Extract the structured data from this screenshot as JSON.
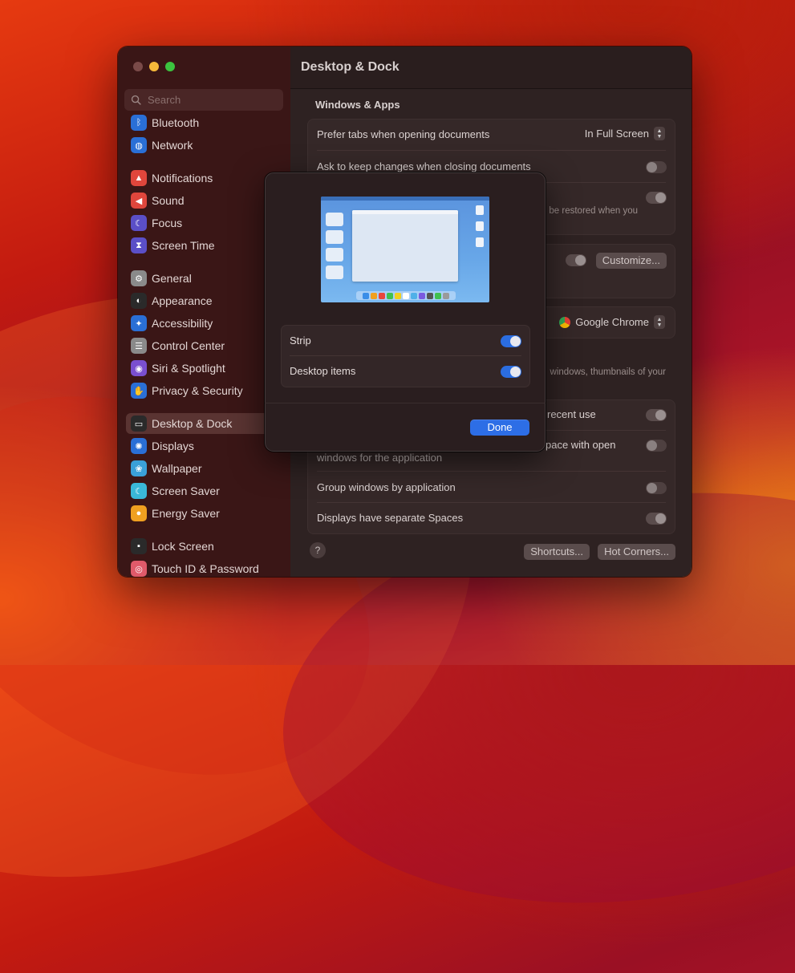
{
  "sidebar": {
    "search_placeholder": "Search",
    "items": [
      {
        "label": "Bluetooth",
        "icon": "bluetooth-icon",
        "color": "#2a6fd6"
      },
      {
        "label": "Network",
        "icon": "globe-icon",
        "color": "#2a6fd6"
      },
      {
        "label": "Notifications",
        "icon": "bell-icon",
        "color": "#e0463c"
      },
      {
        "label": "Sound",
        "icon": "speaker-icon",
        "color": "#e0463c"
      },
      {
        "label": "Focus",
        "icon": "moon-icon",
        "color": "#5b4fc7"
      },
      {
        "label": "Screen Time",
        "icon": "hourglass-icon",
        "color": "#5b4fc7"
      },
      {
        "label": "General",
        "icon": "gear-icon",
        "color": "#8a8a8a"
      },
      {
        "label": "Appearance",
        "icon": "contrast-icon",
        "color": "#2a2a2a"
      },
      {
        "label": "Accessibility",
        "icon": "accessibility-icon",
        "color": "#2a6fd6"
      },
      {
        "label": "Control Center",
        "icon": "switches-icon",
        "color": "#8a8a8a"
      },
      {
        "label": "Siri & Spotlight",
        "icon": "siri-icon",
        "color": "#7a4fd0"
      },
      {
        "label": "Privacy & Security",
        "icon": "hand-icon",
        "color": "#2a6fd6"
      },
      {
        "label": "Desktop & Dock",
        "icon": "dock-icon",
        "color": "#2a2a2a"
      },
      {
        "label": "Displays",
        "icon": "sun-icon",
        "color": "#2a6fd6"
      },
      {
        "label": "Wallpaper",
        "icon": "flower-icon",
        "color": "#3aa0d8"
      },
      {
        "label": "Screen Saver",
        "icon": "screensaver-icon",
        "color": "#3ab8d8"
      },
      {
        "label": "Energy Saver",
        "icon": "bulb-icon",
        "color": "#f0a020"
      },
      {
        "label": "Lock Screen",
        "icon": "lock-icon",
        "color": "#2a2a2a"
      },
      {
        "label": "Touch ID & Password",
        "icon": "fingerprint-icon",
        "color": "#e05a6a"
      }
    ],
    "active_index": 12
  },
  "main": {
    "title": "Desktop & Dock",
    "section_title": "Windows & Apps",
    "prefer_tabs_label": "Prefer tabs when opening documents",
    "prefer_tabs_value": "In Full Screen",
    "ask_keep_label": "Ask to keep changes when closing documents",
    "restored_sub": "be restored when you",
    "customize_label": "Customize...",
    "browser_value": "Google Chrome",
    "thumbnails_sub": "windows, thumbnails of your",
    "recent_use_label": "recent use",
    "space_open_label": "pace with open",
    "windows_for_app_sub": "windows for the application",
    "group_windows_label": "Group windows by application",
    "separate_spaces_label": "Displays have separate Spaces",
    "help_label": "?",
    "shortcuts_label": "Shortcuts...",
    "hot_corners_label": "Hot Corners..."
  },
  "sheet": {
    "strip_label": "Strip",
    "desktop_items_label": "Desktop items",
    "done_label": "Done",
    "strip_on": true,
    "desktop_items_on": true
  },
  "colors": {
    "accent": "#2d6ee6",
    "sidebar_bg": "#3a1616",
    "main_bg": "#2e2222"
  }
}
